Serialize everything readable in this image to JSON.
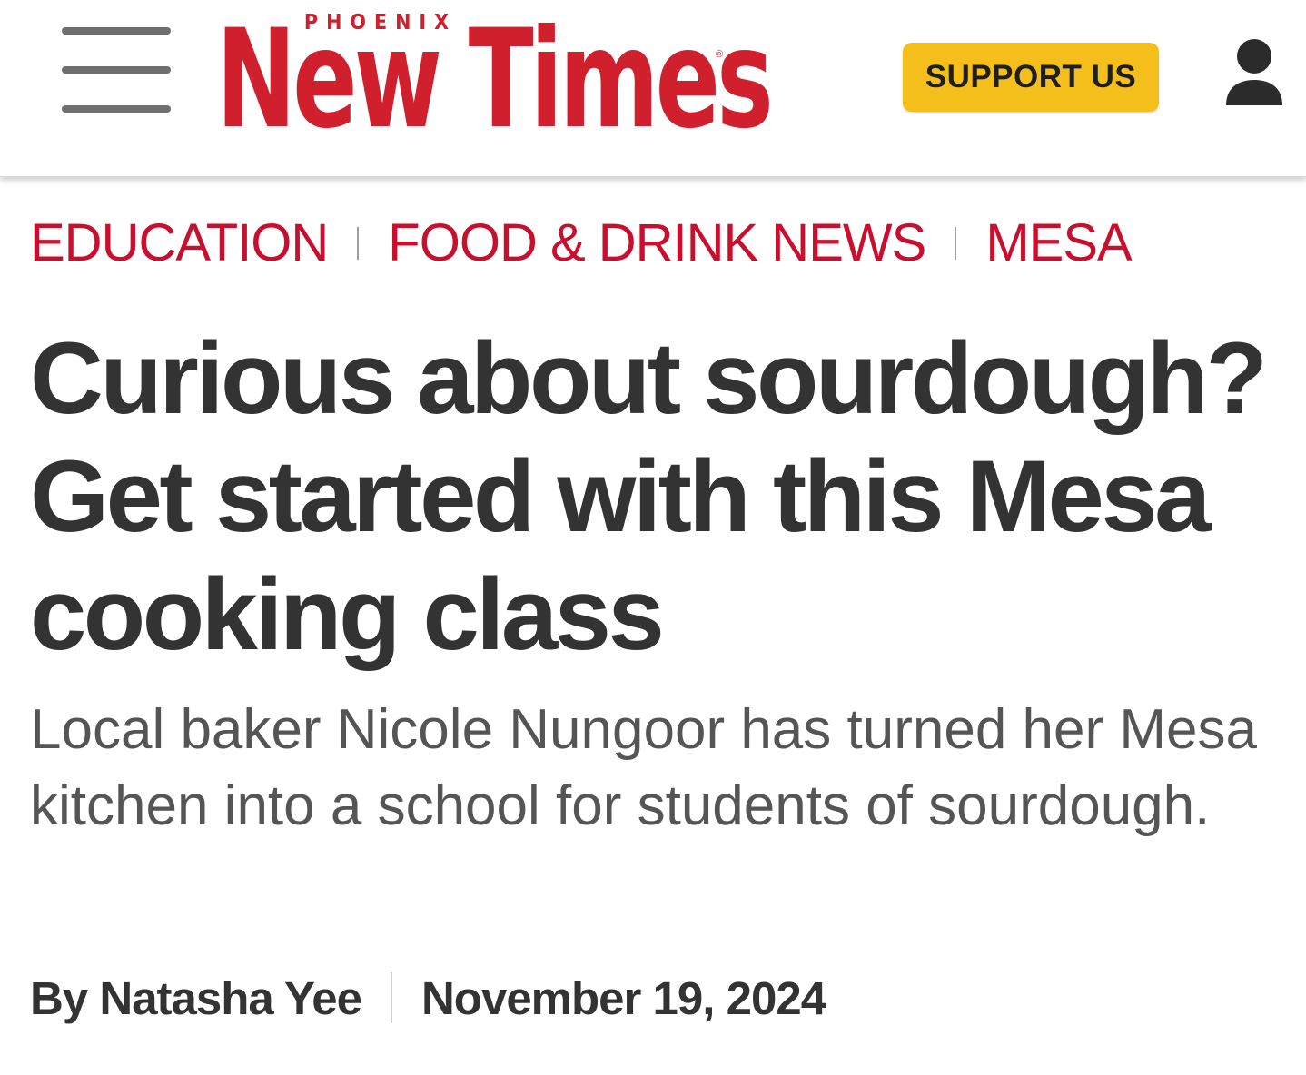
{
  "header": {
    "logo_kicker": "PHOENIX",
    "logo_word": "New Times",
    "logo_reg": "®",
    "support_label": "SUPPORT US"
  },
  "categories": [
    "EDUCATION",
    "FOOD & DRINK NEWS",
    "MESA"
  ],
  "article": {
    "headline": "Curious about sourdough? Get started with this Mesa cooking class",
    "deck": "Local baker Nicole Nungoor has turned her Mesa kitchen into a school for students of sourdough.",
    "byline": "By Natasha Yee",
    "date": "November 19, 2024"
  },
  "colors": {
    "brand_red": "#d0202e",
    "category_red": "#c8102e",
    "support_yellow": "#f5bf1b",
    "text_dark": "#333333",
    "text_gray": "#555555"
  },
  "icons": {
    "menu": "hamburger-menu-icon",
    "account": "user-account-icon"
  }
}
